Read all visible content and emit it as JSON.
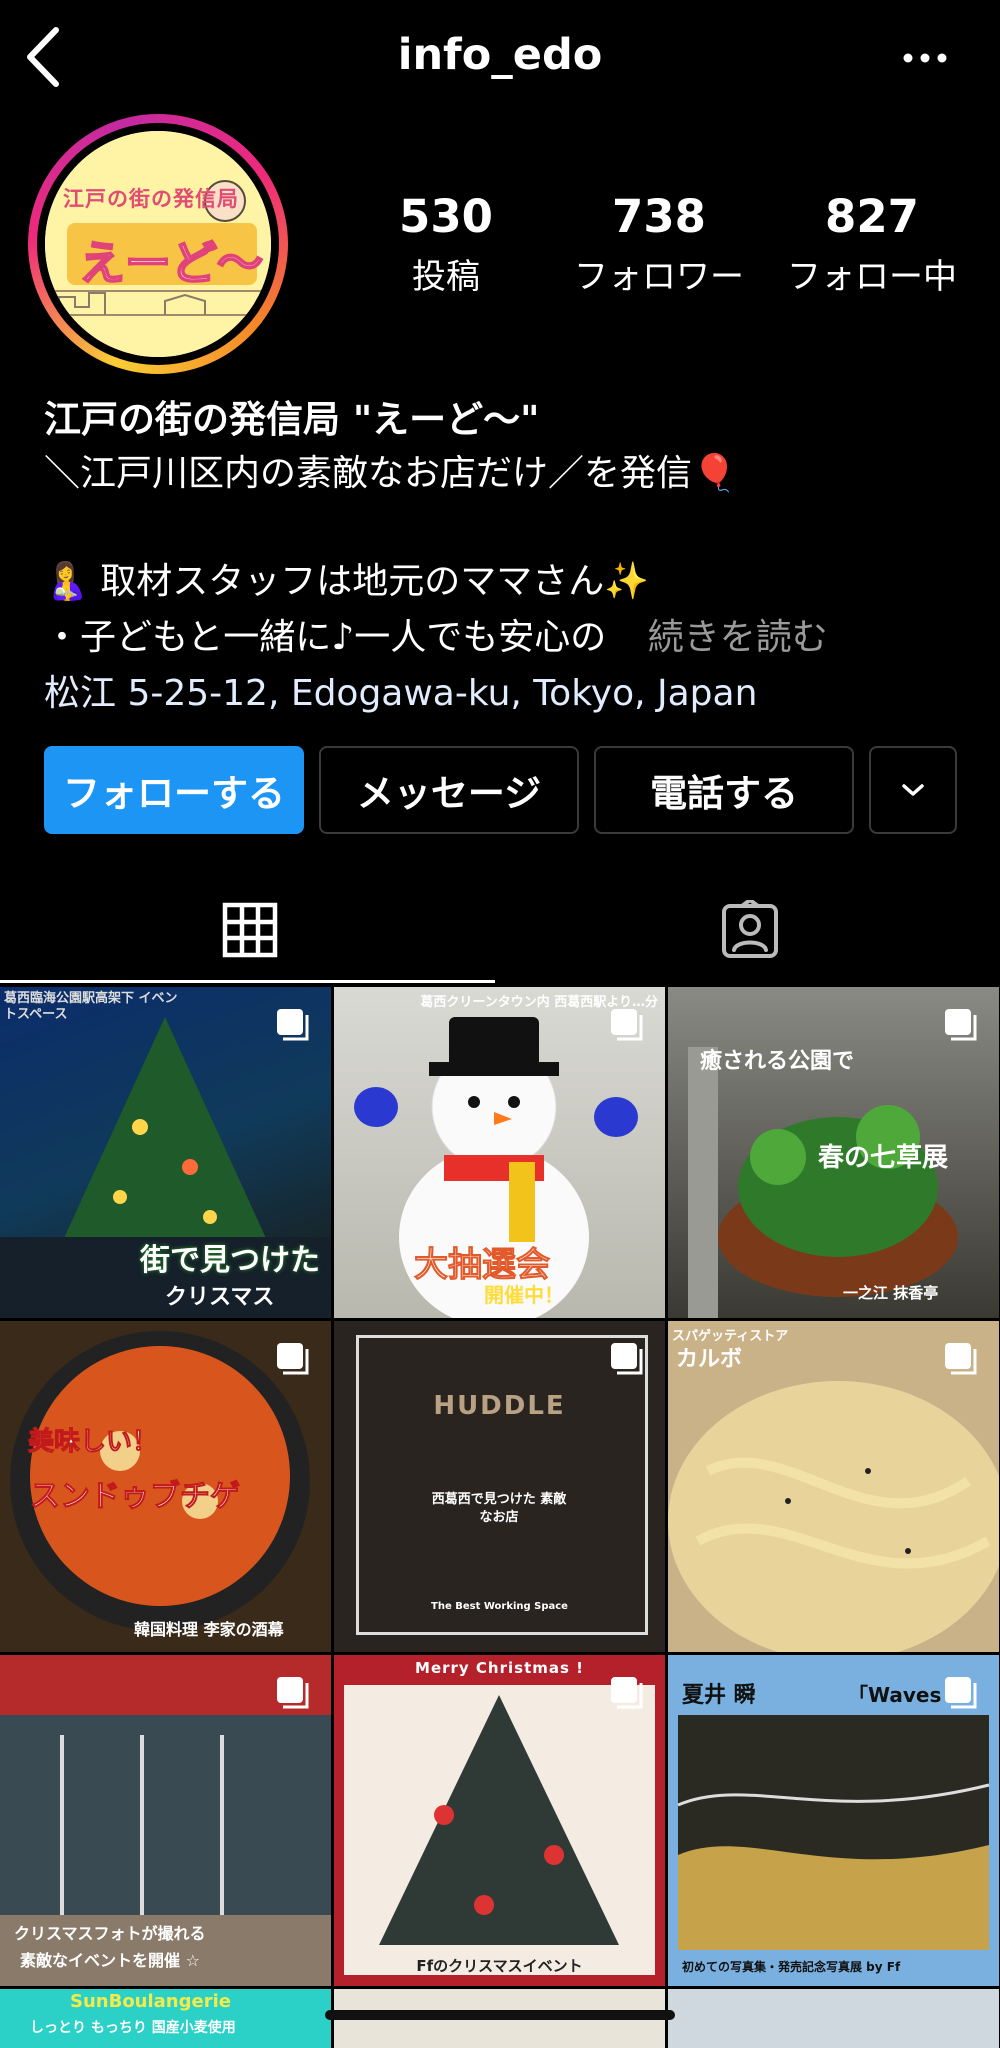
{
  "header": {
    "username": "info_edo"
  },
  "profile": {
    "avatar_text": "えーど〜",
    "avatar_top_text": "江戸の街の発信局",
    "stats": [
      {
        "value": "530",
        "label": "投稿"
      },
      {
        "value": "738",
        "label": "フォロワー"
      },
      {
        "value": "827",
        "label": "フォロー中"
      }
    ],
    "bio": {
      "name": "江戸の街の発信局 \"えーど〜\"",
      "tagline": "＼江戸川区内の素敵なお店だけ／を発信🎈",
      "line1": "🤱 取材スタッフは地元のママさん✨",
      "line2": "・子どもと一緒に♪一人でも安心の",
      "more": "続きを読む",
      "address": "松江 5-25-12, Edogawa-ku, Tokyo, Japan"
    }
  },
  "actions": {
    "follow": "フォローする",
    "message": "メッセージ",
    "call": "電話する"
  },
  "grid": {
    "posts": [
      {
        "caption": "街で見つけた",
        "sub": "クリスマス",
        "location": "葛西臨海公園駅高架下 イベントスペース"
      },
      {
        "caption": "大抽選会",
        "sub": "開催中！",
        "location": "葛西クリーンタウン内 西葛西駅より…分"
      },
      {
        "caption": "春の七草展",
        "sub": "癒される公園で",
        "location": "一之江 抹香亭"
      },
      {
        "caption": "スンドゥブチゲ",
        "sub": "美味しい！",
        "location": "韓国料理 李家の酒幕"
      },
      {
        "caption": "HUDDLE",
        "sub": "西葛西で見つけた 素敵なお店",
        "location": "The Best Working Space"
      },
      {
        "caption": "カルボ",
        "sub": "スパゲッティストア",
        "location": ""
      },
      {
        "caption": "クリスマスフォトが撮れる",
        "sub": "素敵なイベントを開催 ☆",
        "location": ""
      },
      {
        "caption": "Merry Christmas !",
        "sub": "Ffのクリスマスイベント",
        "location": ""
      },
      {
        "caption": "夏井 瞬",
        "sub": "「Waves",
        "location": "初めての写真集・発売記念写真展 by Ff"
      },
      {
        "caption": "SunBoulangerie",
        "sub": "しっとり もっちり 国産小麦使用",
        "location": ""
      }
    ]
  }
}
